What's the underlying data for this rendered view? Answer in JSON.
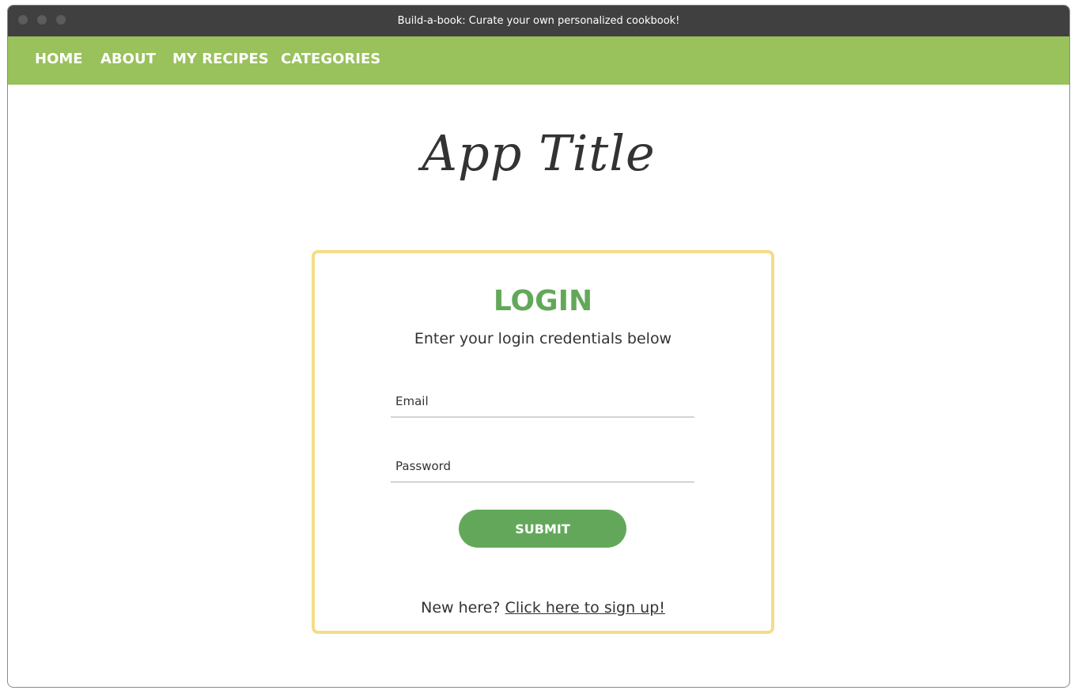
{
  "window": {
    "title": "Build-a-book: Curate your own personalized cookbook!"
  },
  "nav": {
    "items": [
      {
        "label": "HOME"
      },
      {
        "label": "ABOUT"
      },
      {
        "label": "MY RECIPES"
      },
      {
        "label": "CATEGORIES"
      }
    ]
  },
  "app_title": "App Title",
  "login": {
    "heading": "LOGIN",
    "subtitle": "Enter your login credentials below",
    "email_placeholder": "Email",
    "email_value": "",
    "password_placeholder": "Password",
    "password_value": "",
    "submit_label": "SUBMIT",
    "signup_prompt": "New here?",
    "signup_link": "Click here to sign up!"
  },
  "colors": {
    "titlebar": "#404040",
    "nav_bg": "#99c15c",
    "accent_green": "#63a85a",
    "card_border": "#f5dc8a"
  }
}
